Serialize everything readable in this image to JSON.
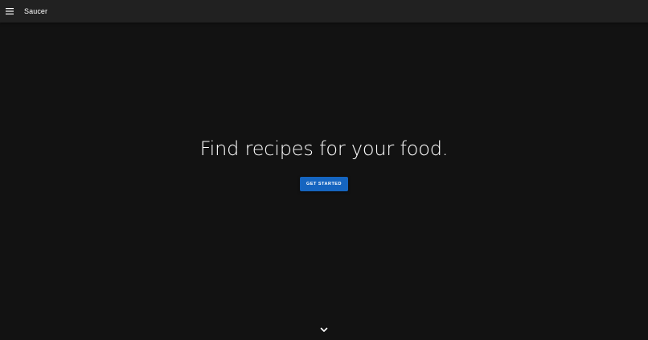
{
  "app": {
    "title": "Saucer",
    "menu_icon": "hamburger-menu-icon"
  },
  "hero": {
    "headline": "Find recipes for your food.",
    "cta_label": "GET STARTED",
    "scroll_icon": "chevron-down-icon"
  },
  "colors": {
    "background": "#121212",
    "appbar": "#212121",
    "primary": "#1565c0",
    "text": "#ffffff"
  }
}
